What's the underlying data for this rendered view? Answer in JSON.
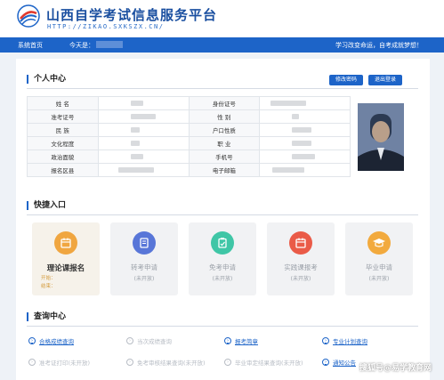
{
  "header": {
    "title": "山西自学考试信息服务平台",
    "url": "HTTP://ZIKAO.SXKSZX.CN/"
  },
  "nav": {
    "home": "系统首页",
    "today_label": "今天是：",
    "slogan": "学习改变命运，自考成就梦想！"
  },
  "personal": {
    "title": "个人中心",
    "edit_password": "修改密码",
    "logout": "退出登录",
    "rows": [
      {
        "l1": "姓    名",
        "l2": "身份证号"
      },
      {
        "l1": "准考证号",
        "l2": "性    别"
      },
      {
        "l1": "民    族",
        "l2": "户口性质"
      },
      {
        "l1": "文化程度",
        "l2": "职    业"
      },
      {
        "l1": "政治面貌",
        "l2": "手机号"
      },
      {
        "l1": "报名区县",
        "l2": "电子邮箱"
      }
    ]
  },
  "quick": {
    "title": "快捷入口",
    "cards": [
      {
        "label": "理论课报名",
        "sub": "",
        "time1": "开始：",
        "time2": "结束：",
        "color": "#f0a640",
        "icon": "calendar-icon"
      },
      {
        "label": "转考申请",
        "sub": "(未开放)",
        "color": "#5876d8",
        "icon": "document-icon"
      },
      {
        "label": "免考申请",
        "sub": "(未开放)",
        "color": "#3fc6a6",
        "icon": "clipboard-icon"
      },
      {
        "label": "实践课报考",
        "sub": "(未开放)",
        "color": "#ea5b48",
        "icon": "calendar-icon"
      },
      {
        "label": "毕业申请",
        "sub": "(未开放)",
        "color": "#f2aa3e",
        "icon": "graduation-cap-icon"
      }
    ]
  },
  "query": {
    "title": "查询中心",
    "row1": [
      {
        "label": "合格成绩查询",
        "on": true
      },
      {
        "label": "当次成绩查询",
        "on": false
      },
      {
        "label": "报考简章",
        "on": true
      },
      {
        "label": "专业计划查询",
        "on": true
      }
    ],
    "row2": [
      {
        "label": "准考证打印(未开放)",
        "on": false
      },
      {
        "label": "免考审核结果查询(未开放)",
        "on": false
      },
      {
        "label": "毕业审定结果查询(未开放)",
        "on": false
      },
      {
        "label": "通知公告",
        "on": true
      }
    ]
  },
  "watermark": "搜狐号@易学教育网"
}
